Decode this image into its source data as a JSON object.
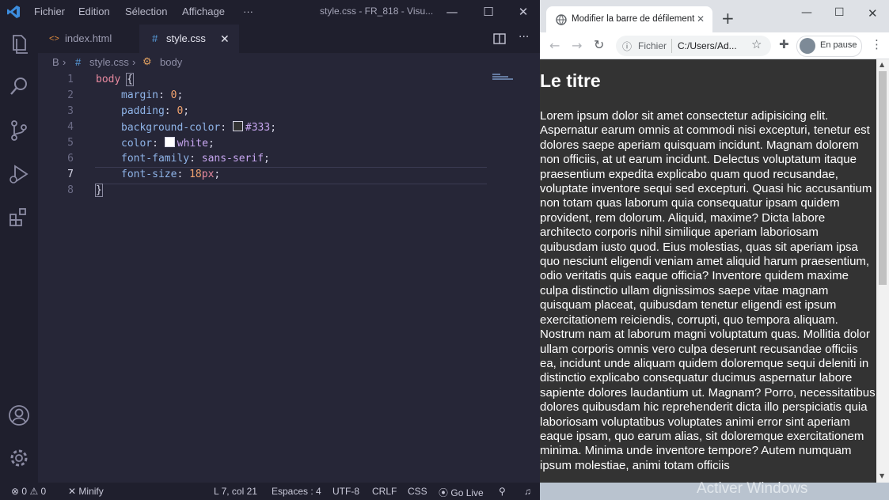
{
  "vscode": {
    "menu": [
      "Fichier",
      "Edition",
      "Sélection",
      "Affichage",
      "···"
    ],
    "window_title": "style.css - FR_818 - Visu...",
    "tabs": [
      {
        "label": "index.html",
        "icon": "<>"
      },
      {
        "label": "style.css",
        "icon": "#"
      }
    ],
    "breadcrumb": {
      "folder": "B",
      "file": "style.css",
      "symbol": "body"
    },
    "code": [
      {
        "ln": "1",
        "sel": "body",
        "brace": "{"
      },
      {
        "ln": "2",
        "prop": "margin",
        "val": "0"
      },
      {
        "ln": "3",
        "prop": "padding",
        "val": "0"
      },
      {
        "ln": "4",
        "prop": "background-color",
        "val": "#333",
        "swatch": "#333333"
      },
      {
        "ln": "5",
        "prop": "color",
        "val": "white",
        "swatch": "#ffffff"
      },
      {
        "ln": "6",
        "prop": "font-family",
        "val": "sans-serif"
      },
      {
        "ln": "7",
        "prop": "font-size",
        "val": "18",
        "unit": "px"
      },
      {
        "ln": "8",
        "brace": "}"
      }
    ],
    "status": {
      "errors": "0",
      "warnings": "0",
      "minify": "Minify",
      "position": "L 7, col 21",
      "spaces": "Espaces : 4",
      "encoding": "UTF-8",
      "eol": "CRLF",
      "language": "CSS",
      "golive": "Go Live"
    }
  },
  "browser": {
    "tab_title": "Modifier la barre de défilement",
    "new_tab": "+",
    "address_prefix": "Fichier",
    "address": "C:/Users/Ad...",
    "profile_status": "En pause",
    "page_heading": "Le titre",
    "page_text": "Lorem ipsum dolor sit amet consectetur adipisicing elit. Aspernatur earum omnis at commodi nisi excepturi, tenetur est dolores saepe aperiam quisquam incidunt. Magnam dolorem non officiis, at ut earum incidunt. Delectus voluptatum itaque praesentium expedita explicabo quam quod recusandae, voluptate inventore sequi sed excepturi. Quasi hic accusantium non totam quas laborum quia consequatur ipsam quidem provident, rem dolorum. Aliquid, maxime? Dicta labore architecto corporis nihil similique aperiam laboriosam quibusdam iusto quod. Eius molestias, quas sit aperiam ipsa quo nesciunt eligendi veniam amet aliquid harum praesentium, odio veritatis quis eaque officia? Inventore quidem maxime culpa distinctio ullam dignissimos saepe vitae magnam quisquam placeat, quibusdam tenetur eligendi est ipsum exercitationem reiciendis, corrupti, quo tempora aliquam. Nostrum nam at laborum magni voluptatum quas. Mollitia dolor ullam corporis omnis vero culpa deserunt recusandae officiis ea, incidunt unde aliquam quidem doloremque sequi deleniti in distinctio explicabo consequatur ducimus aspernatur labore sapiente dolores laudantium ut. Magnam? Porro, necessitatibus dolores quibusdam hic reprehenderit dicta illo perspiciatis quia laboriosam voluptatibus voluptates animi error sint aperiam eaque ipsam, quo earum alias, sit doloremque exercitationem minima. Minima unde inventore tempore? Autem numquam ipsum molestiae, animi totam officiis"
  },
  "watermark": "Activer Windows",
  "colors": {
    "editor_bg": "#262637",
    "page_bg": "#333333",
    "accent_vscode": "#3c8dde"
  }
}
